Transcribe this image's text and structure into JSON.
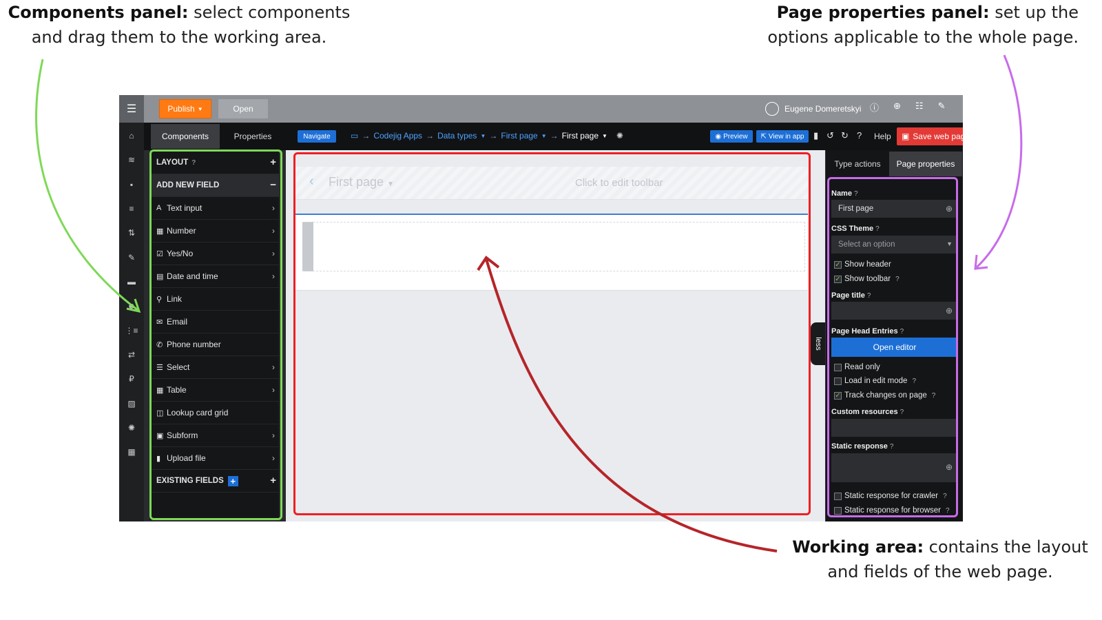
{
  "annotations": {
    "components": {
      "title": "Components panel:",
      "text_line1": " select components",
      "text_line2": "and drag them to the working area."
    },
    "page_props": {
      "title": "Page properties panel:",
      "text_line1": " set up the",
      "text_line2": "options applicable to the whole page."
    },
    "work": {
      "title": "Working area:",
      "text_line1": " contains the layout",
      "text_line2": "and fields of the web page."
    }
  },
  "colors": {
    "components_box": "#7ed957",
    "working_box": "#ed1f24",
    "properties_box": "#c86bea",
    "accent": "#1d6fd6",
    "publish": "#ff7a13",
    "save": "#e33a36"
  },
  "topbar": {
    "publish_label": "Publish",
    "open_label": "Open",
    "user_name": "Eugene Domeretskyi",
    "icons": [
      "info-icon",
      "globe-icon",
      "list-icon",
      "wrench-icon"
    ]
  },
  "rail": {
    "icons": [
      "home-icon",
      "database-icon",
      "lock-icon",
      "menu-icon",
      "sort-icon",
      "pencil-icon",
      "archive-icon",
      "users-icon",
      "ordered-list-icon",
      "exchange-icon",
      "currency-icon",
      "image-icon",
      "gear-icon",
      "grid-icon"
    ]
  },
  "bar2": {
    "tab_components": "Components",
    "tab_properties": "Properties",
    "navigate_label": "Navigate",
    "breadcrumb": [
      "Codejig Apps",
      "Data types",
      "First page",
      "First page"
    ],
    "preview_label": "Preview",
    "view_in_app_label": "View in app",
    "help_label": "Help",
    "save_label": "Save web page"
  },
  "components": {
    "layout_label": "LAYOUT",
    "add_new_field_label": "ADD NEW FIELD",
    "items": [
      {
        "label": "Text input",
        "icon": "A",
        "chevron": true
      },
      {
        "label": "Number",
        "icon": "▦",
        "chevron": true
      },
      {
        "label": "Yes/No",
        "icon": "☑",
        "chevron": true
      },
      {
        "label": "Date and time",
        "icon": "▤",
        "chevron": true
      },
      {
        "label": "Link",
        "icon": "⚲",
        "chevron": false
      },
      {
        "label": "Email",
        "icon": "✉",
        "chevron": false
      },
      {
        "label": "Phone number",
        "icon": "✆",
        "chevron": false
      },
      {
        "label": "Select",
        "icon": "☰",
        "chevron": true
      },
      {
        "label": "Table",
        "icon": "▦",
        "chevron": true
      },
      {
        "label": "Lookup card grid",
        "icon": "◫",
        "chevron": false
      },
      {
        "label": "Subform",
        "icon": "▣",
        "chevron": true
      },
      {
        "label": "Upload file",
        "icon": "▮",
        "chevron": true
      }
    ],
    "existing_fields_label": "EXISTING FIELDS"
  },
  "work": {
    "toolbar_title": "First page",
    "toolbar_hint": "Click to edit toolbar",
    "less_label": "less"
  },
  "props": {
    "tab_type_actions": "Type actions",
    "tab_page_properties": "Page properties",
    "name_label": "Name",
    "name_value": "First page",
    "css_theme_label": "CSS Theme",
    "css_theme_placeholder": "Select an option",
    "show_header": {
      "label": "Show header",
      "checked": true
    },
    "show_toolbar": {
      "label": "Show toolbar",
      "checked": true
    },
    "page_title_label": "Page title",
    "page_title_value": "",
    "page_head_entries_label": "Page Head Entries",
    "open_editor_label": "Open editor",
    "read_only": {
      "label": "Read only",
      "checked": false
    },
    "load_in_edit_mode": {
      "label": "Load in edit mode",
      "checked": false
    },
    "track_changes": {
      "label": "Track changes on page",
      "checked": true
    },
    "custom_resources_label": "Custom resources",
    "static_response_label": "Static response",
    "static_crawler": {
      "label": "Static response for crawler",
      "checked": false
    },
    "static_browser": {
      "label": "Static response for browser",
      "checked": false
    }
  }
}
